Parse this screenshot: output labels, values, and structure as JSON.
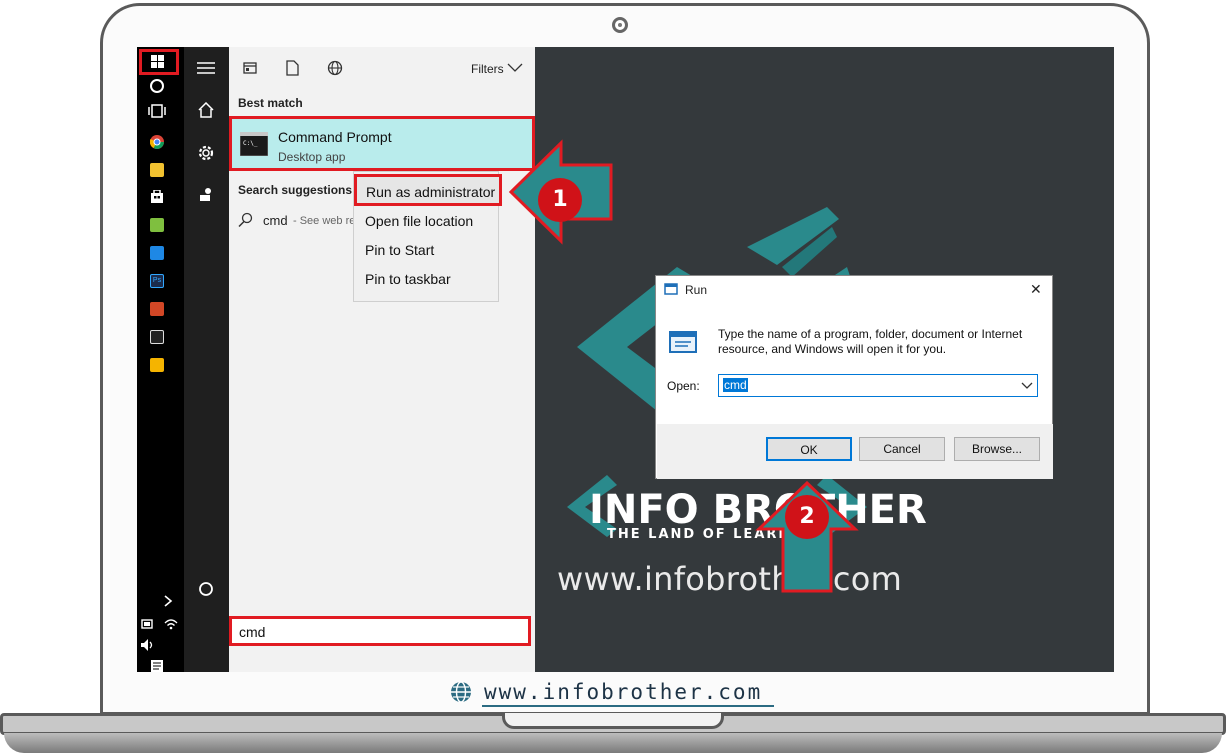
{
  "start_menu": {
    "filters_label": "Filters",
    "best_match_label": "Best match",
    "result_title": "Command Prompt",
    "result_subtitle": "Desktop app",
    "search_suggestions_label": "Search suggestions",
    "suggestion_query": "cmd",
    "suggestion_hint": "- See web re",
    "search_value": "cmd"
  },
  "context_menu": {
    "items": [
      "Run as administrator",
      "Open file location",
      "Pin to Start",
      "Pin to taskbar"
    ]
  },
  "run_dialog": {
    "title": "Run",
    "close_glyph": "✕",
    "description": "Type the name of a program, folder, document or Internet resource, and Windows will open it for you.",
    "open_label": "Open:",
    "open_value": "cmd",
    "ok_label": "OK",
    "cancel_label": "Cancel",
    "browse_label": "Browse..."
  },
  "watermark": {
    "brand_name": "INFO BROTHER",
    "brand_tagline": "THE LAND OF LEARNING",
    "brand_url": "www.infobrother.com"
  },
  "annotations": {
    "step1": "1",
    "step2": "2"
  },
  "footer": {
    "url": "www.infobrother.com"
  },
  "colors": {
    "highlight": "#e11b22",
    "teal": "#2a8a8c",
    "selection": "#b9ecec",
    "accent": "#0078d7"
  }
}
